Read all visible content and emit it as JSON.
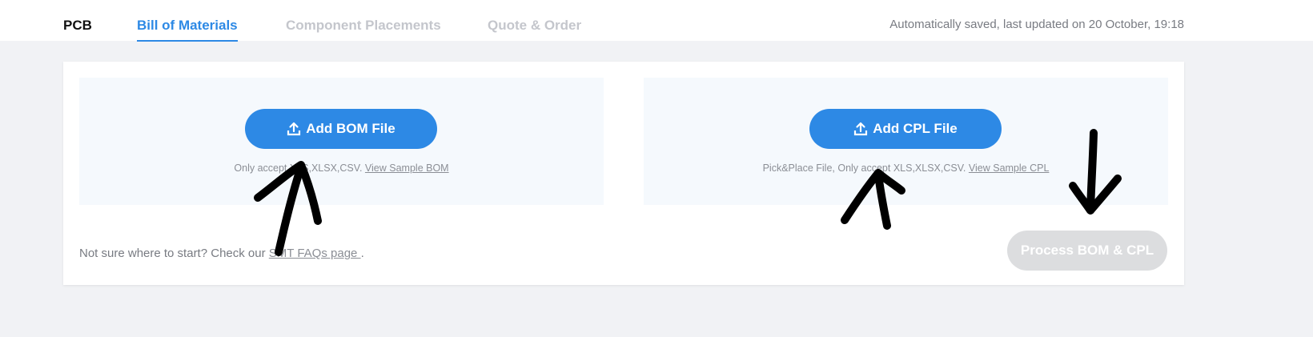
{
  "tabs": [
    {
      "label": "PCB"
    },
    {
      "label": "Bill of Materials"
    },
    {
      "label": "Component Placements"
    },
    {
      "label": "Quote & Order"
    }
  ],
  "save_status": "Automatically saved, last updated on 20 October, 19:18",
  "bom": {
    "button_label": "Add BOM File",
    "note": "Only accept XLS,XLSX,CSV.",
    "sample_link": "View Sample BOM",
    "icon": "upload-icon"
  },
  "cpl": {
    "button_label": "Add CPL File",
    "note": "Pick&Place File, Only accept XLS,XLSX,CSV.",
    "sample_link": "View Sample CPL",
    "icon": "upload-icon"
  },
  "help": {
    "prefix": "Not sure where to start? Check our ",
    "link": "SMT FAQs page ",
    "suffix": "."
  },
  "process_button_label": "Process BOM & CPL",
  "colors": {
    "accent": "#2d89e5",
    "disabled": "#dcdddf",
    "panel": "#f5f9fd",
    "page_background": "#f1f2f5"
  }
}
